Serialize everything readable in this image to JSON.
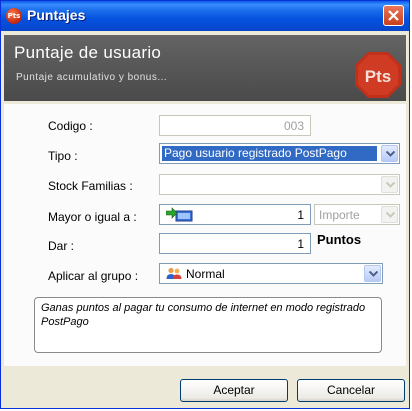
{
  "window": {
    "title": "Puntajes",
    "icon_text": "Pts"
  },
  "header": {
    "title": "Puntaje de usuario",
    "subtitle": "Puntaje acumulativo y bonus...",
    "logo_text": "Pts"
  },
  "form": {
    "codigo": {
      "label": "Codigo :",
      "value": "003"
    },
    "tipo": {
      "label": "Tipo :",
      "value": "Pago usuario registrado PostPago"
    },
    "stock": {
      "label": "Stock Familias :",
      "value": ""
    },
    "mayor": {
      "label": "Mayor o igual  a :",
      "value": "1",
      "unit_value": "Importe"
    },
    "dar": {
      "label": "Dar :",
      "value": "1",
      "unit": "Puntos"
    },
    "grupo": {
      "label": "Aplicar al grupo :",
      "value": "Normal"
    },
    "description": "Ganas puntos al pagar tu consumo de internet en modo registrado PostPago"
  },
  "buttons": {
    "accept": "Aceptar",
    "cancel": "Cancelar"
  }
}
